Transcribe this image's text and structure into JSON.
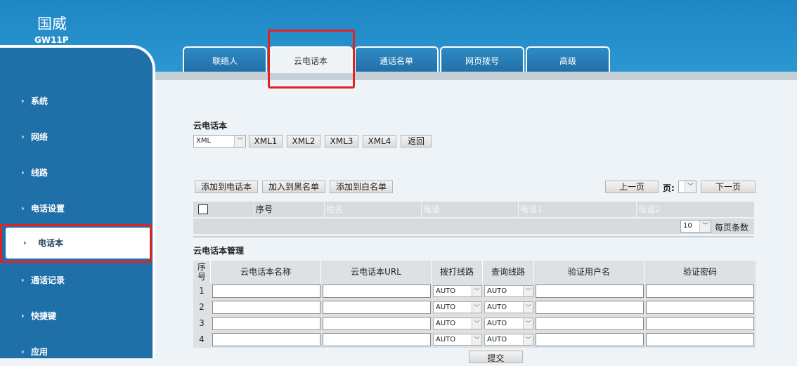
{
  "brand": {
    "title": "国威",
    "model": "GW11P"
  },
  "sidebar": {
    "items": [
      {
        "label": "系统",
        "arrow": "›"
      },
      {
        "label": "网络",
        "arrow": "›"
      },
      {
        "label": "线路",
        "arrow": "›"
      },
      {
        "label": "电话设置",
        "arrow": "›"
      },
      {
        "label": "电话本",
        "arrow": "›"
      },
      {
        "label": "通话记录",
        "arrow": "›"
      },
      {
        "label": "快捷键",
        "arrow": "›"
      },
      {
        "label": "应用",
        "arrow": "›"
      }
    ]
  },
  "tabs": [
    {
      "label": "联络人"
    },
    {
      "label": "云电话本"
    },
    {
      "label": "通话名单"
    },
    {
      "label": "网页拨号"
    },
    {
      "label": "高级"
    }
  ],
  "cloud": {
    "title": "云电话本",
    "format_value": "XML",
    "buttons": [
      "XML1",
      "XML2",
      "XML3",
      "XML4",
      "返回"
    ]
  },
  "list": {
    "actions": [
      "添加到电话本",
      "加入到黑名单",
      "添加到白名单"
    ],
    "prev": "上一页",
    "page_label": "页:",
    "next": "下一页",
    "columns": [
      "序号",
      "姓名",
      "电话",
      "电话1",
      "电话2"
    ],
    "per_page_value": "10",
    "per_page_label": "每页条数"
  },
  "mgmt": {
    "title": "云电话本管理",
    "headers": [
      "序\n号",
      "云电话本名称",
      "云电话本URL",
      "拨打线路",
      "查询线路",
      "验证用户名",
      "验证密码"
    ],
    "rows": [
      {
        "num": "1",
        "dial": "AUTO",
        "query": "AUTO"
      },
      {
        "num": "2",
        "dial": "AUTO",
        "query": "AUTO"
      },
      {
        "num": "3",
        "dial": "AUTO",
        "query": "AUTO"
      },
      {
        "num": "4",
        "dial": "AUTO",
        "query": "AUTO"
      }
    ],
    "submit": "提交"
  },
  "colors": {
    "header": "#2b97d1",
    "sidebar": "#1f6fa8",
    "highlight": "#e62020"
  }
}
